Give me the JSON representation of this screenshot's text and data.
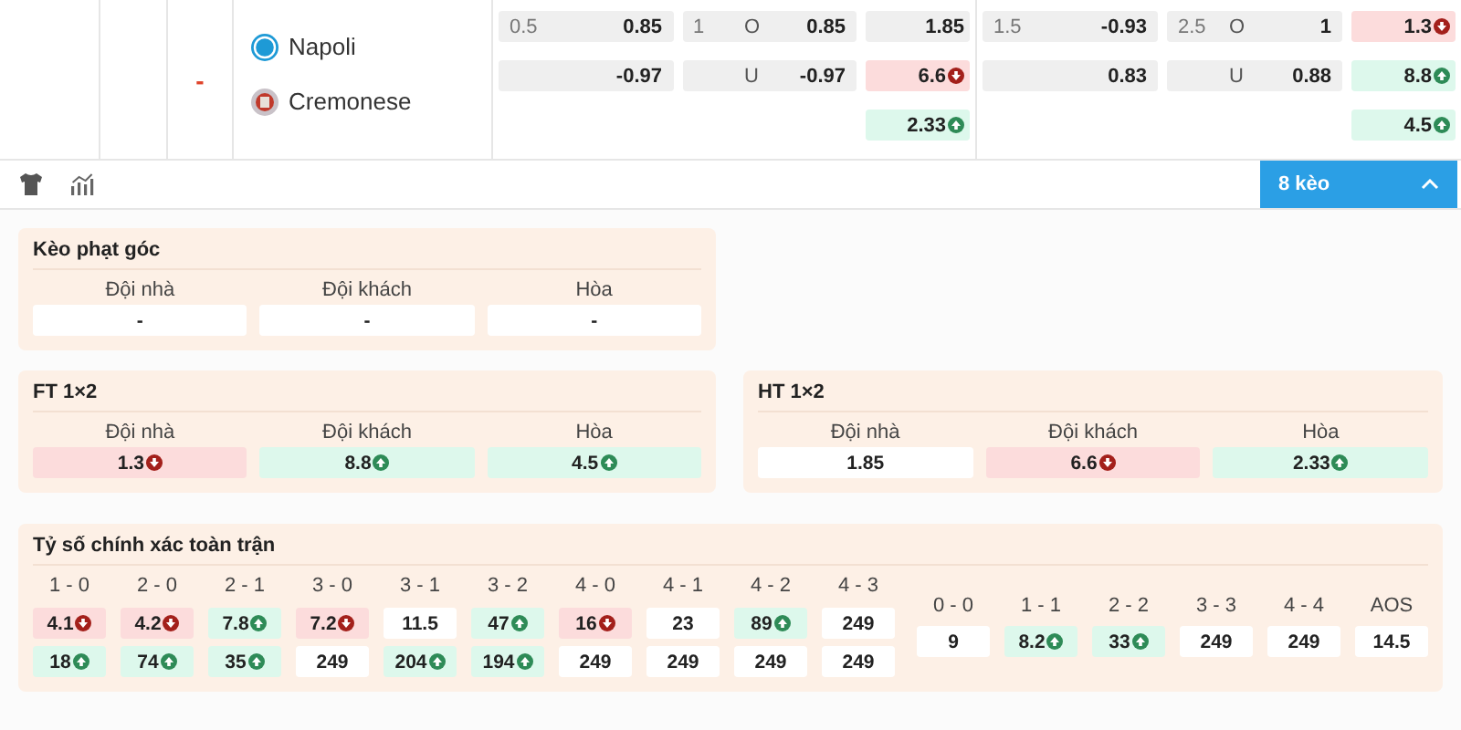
{
  "match": {
    "score": "-",
    "home": {
      "name": "Napoli",
      "kind": "napoli"
    },
    "away": {
      "name": "Cremonese",
      "kind": "cremonese"
    },
    "odds_groups": [
      {
        "handicap": [
          {
            "line": "0.5",
            "value": "0.85"
          },
          {
            "value": "-0.97"
          }
        ],
        "over_under": [
          {
            "line": "1",
            "side": "O",
            "value": "0.85"
          },
          {
            "side": "U",
            "value": "-0.97"
          }
        ],
        "one_x_two": [
          {
            "value": "1.85",
            "kind": "plain"
          },
          {
            "value": "6.6",
            "kind": "down"
          },
          {
            "value": "2.33",
            "kind": "up"
          }
        ]
      },
      {
        "handicap": [
          {
            "line": "1.5",
            "value": "-0.93"
          },
          {
            "value": "0.83"
          }
        ],
        "over_under": [
          {
            "line": "2.5",
            "side": "O",
            "value": "1"
          },
          {
            "side": "U",
            "value": "0.88"
          }
        ],
        "one_x_two": [
          {
            "value": "1.3",
            "kind": "down"
          },
          {
            "value": "8.8",
            "kind": "up"
          },
          {
            "value": "4.5",
            "kind": "up"
          }
        ]
      }
    ]
  },
  "toolbar": {
    "expand_button": {
      "label": "8 kèo",
      "expanded": true
    }
  },
  "markets": [
    {
      "title": "Kèo phạt góc",
      "columns": [
        {
          "label": "Đội nhà",
          "value": "-",
          "kind": "plain"
        },
        {
          "label": "Đội khách",
          "value": "-",
          "kind": "plain"
        },
        {
          "label": "Hòa",
          "value": "-",
          "kind": "plain"
        }
      ]
    },
    {
      "title": "FT 1×2",
      "columns": [
        {
          "label": "Đội nhà",
          "value": "1.3",
          "kind": "down"
        },
        {
          "label": "Đội khách",
          "value": "8.8",
          "kind": "up"
        },
        {
          "label": "Hòa",
          "value": "4.5",
          "kind": "up"
        }
      ]
    },
    {
      "title": "HT 1×2",
      "columns": [
        {
          "label": "Đội nhà",
          "value": "1.85",
          "kind": "plain"
        },
        {
          "label": "Đội khách",
          "value": "6.6",
          "kind": "down"
        },
        {
          "label": "Hòa",
          "value": "2.33",
          "kind": "up"
        }
      ]
    }
  ],
  "correct_score": {
    "title": "Tỷ số chính xác toàn trận",
    "wins": [
      {
        "score": "1 - 0",
        "odds": [
          {
            "value": "4.1",
            "kind": "down"
          },
          {
            "value": "18",
            "kind": "up"
          }
        ]
      },
      {
        "score": "2 - 0",
        "odds": [
          {
            "value": "4.2",
            "kind": "down"
          },
          {
            "value": "74",
            "kind": "up"
          }
        ]
      },
      {
        "score": "2 - 1",
        "odds": [
          {
            "value": "7.8",
            "kind": "up"
          },
          {
            "value": "35",
            "kind": "up"
          }
        ]
      },
      {
        "score": "3 - 0",
        "odds": [
          {
            "value": "7.2",
            "kind": "down"
          },
          {
            "value": "249",
            "kind": "plain"
          }
        ]
      },
      {
        "score": "3 - 1",
        "odds": [
          {
            "value": "11.5",
            "kind": "plain"
          },
          {
            "value": "204",
            "kind": "up"
          }
        ]
      },
      {
        "score": "3 - 2",
        "odds": [
          {
            "value": "47",
            "kind": "up"
          },
          {
            "value": "194",
            "kind": "up"
          }
        ]
      },
      {
        "score": "4 - 0",
        "odds": [
          {
            "value": "16",
            "kind": "down"
          },
          {
            "value": "249",
            "kind": "plain"
          }
        ]
      },
      {
        "score": "4 - 1",
        "odds": [
          {
            "value": "23",
            "kind": "plain"
          },
          {
            "value": "249",
            "kind": "plain"
          }
        ]
      },
      {
        "score": "4 - 2",
        "odds": [
          {
            "value": "89",
            "kind": "up"
          },
          {
            "value": "249",
            "kind": "plain"
          }
        ]
      },
      {
        "score": "4 - 3",
        "odds": [
          {
            "value": "249",
            "kind": "plain"
          },
          {
            "value": "249",
            "kind": "plain"
          }
        ]
      }
    ],
    "draws": [
      {
        "score": "0 - 0",
        "odds": [
          {
            "value": "9",
            "kind": "plain"
          }
        ]
      },
      {
        "score": "1 - 1",
        "odds": [
          {
            "value": "8.2",
            "kind": "up"
          }
        ]
      },
      {
        "score": "2 - 2",
        "odds": [
          {
            "value": "33",
            "kind": "up"
          }
        ]
      },
      {
        "score": "3 - 3",
        "odds": [
          {
            "value": "249",
            "kind": "plain"
          }
        ]
      },
      {
        "score": "4 - 4",
        "odds": [
          {
            "value": "249",
            "kind": "plain"
          }
        ]
      },
      {
        "score": "AOS",
        "odds": [
          {
            "value": "14.5",
            "kind": "plain"
          }
        ]
      }
    ]
  }
}
